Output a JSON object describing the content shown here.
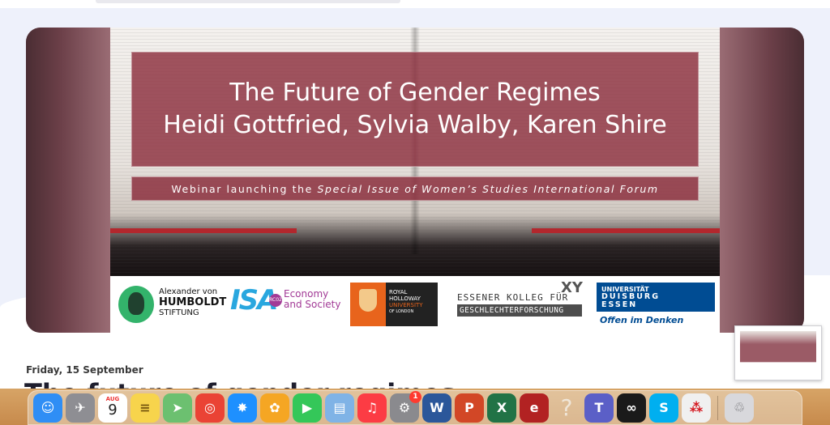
{
  "banner": {
    "title_line1": "The Future of Gender Regimes",
    "title_line2": "Heidi Gottfried, Sylvia Walby, Karen Shire",
    "subtitle_prefix": "Webinar launching the ",
    "subtitle_italic": "Special Issue of Women’s Studies International Forum"
  },
  "logos": {
    "humboldt_line1": "Alexander von",
    "humboldt_line2": "HUMBOLDT",
    "humboldt_line3": "STIFTUNG",
    "isa_mark": "ISA",
    "isa_rc": "RC02",
    "isa_text_line1": "Economy",
    "isa_text_line2": "and Society",
    "rhul_line1": "ROYAL",
    "rhul_line2": "HOLLOWAY",
    "rhul_line3": "UNIVERSITY",
    "rhul_line4": "OF LONDON",
    "ekfg_line1": "ESSENER KOLLEG FÜR",
    "ekfg_line2": "GESCHLECHTERFORSCHUNG",
    "ekfg_mark": "XY",
    "ude_line1": "UNIVERSITÄT",
    "ude_line2": "DUISBURG",
    "ude_line3": "ESSEN",
    "ude_slogan": "Offen im Denken"
  },
  "event": {
    "date": "Friday, 15 September",
    "title": "The future of gender regimes"
  },
  "dock": {
    "calendar_month": "AUG",
    "calendar_day": "9",
    "system_prefs_badge": "1",
    "items": [
      {
        "name": "finder",
        "color": "#2f8ef5",
        "glyph": "☺"
      },
      {
        "name": "launchpad",
        "color": "#8e8e93",
        "glyph": "✈"
      },
      {
        "name": "calendar",
        "color": "#ffffff",
        "glyph": ""
      },
      {
        "name": "notes",
        "color": "#f7d44c",
        "glyph": "≡"
      },
      {
        "name": "maps",
        "color": "#6cc070",
        "glyph": "➤"
      },
      {
        "name": "chrome",
        "color": "#ea4335",
        "glyph": "◎"
      },
      {
        "name": "safari",
        "color": "#1e90ff",
        "glyph": "✸"
      },
      {
        "name": "photos",
        "color": "#f5a623",
        "glyph": "✿"
      },
      {
        "name": "facetime",
        "color": "#34c759",
        "glyph": "▶"
      },
      {
        "name": "preview",
        "color": "#7fb3e6",
        "glyph": "▤"
      },
      {
        "name": "music",
        "color": "#fc3c44",
        "glyph": "♫"
      },
      {
        "name": "system-preferences",
        "color": "#8a8a8e",
        "glyph": "⚙"
      },
      {
        "name": "word",
        "color": "#2b579a",
        "glyph": "W"
      },
      {
        "name": "powerpoint",
        "color": "#d24726",
        "glyph": "P"
      },
      {
        "name": "excel",
        "color": "#217346",
        "glyph": "X"
      },
      {
        "name": "app-e",
        "color": "#b22222",
        "glyph": "e"
      },
      {
        "name": "help",
        "color": "transparent",
        "glyph": "?"
      },
      {
        "name": "teams",
        "color": "#5b5fc7",
        "glyph": "T"
      },
      {
        "name": "webex",
        "color": "#1a1a1a",
        "glyph": "∞"
      },
      {
        "name": "skype",
        "color": "#00aff0",
        "glyph": "S"
      },
      {
        "name": "acrobat",
        "color": "#f0f0f0",
        "glyph": "⁂"
      },
      {
        "name": "trash",
        "color": "#d8d8dc",
        "glyph": "♲"
      }
    ]
  },
  "colors": {
    "banner_overlay": "#8c303e",
    "page_background": "#eef1fb",
    "dock_background": "#c78a4c"
  }
}
